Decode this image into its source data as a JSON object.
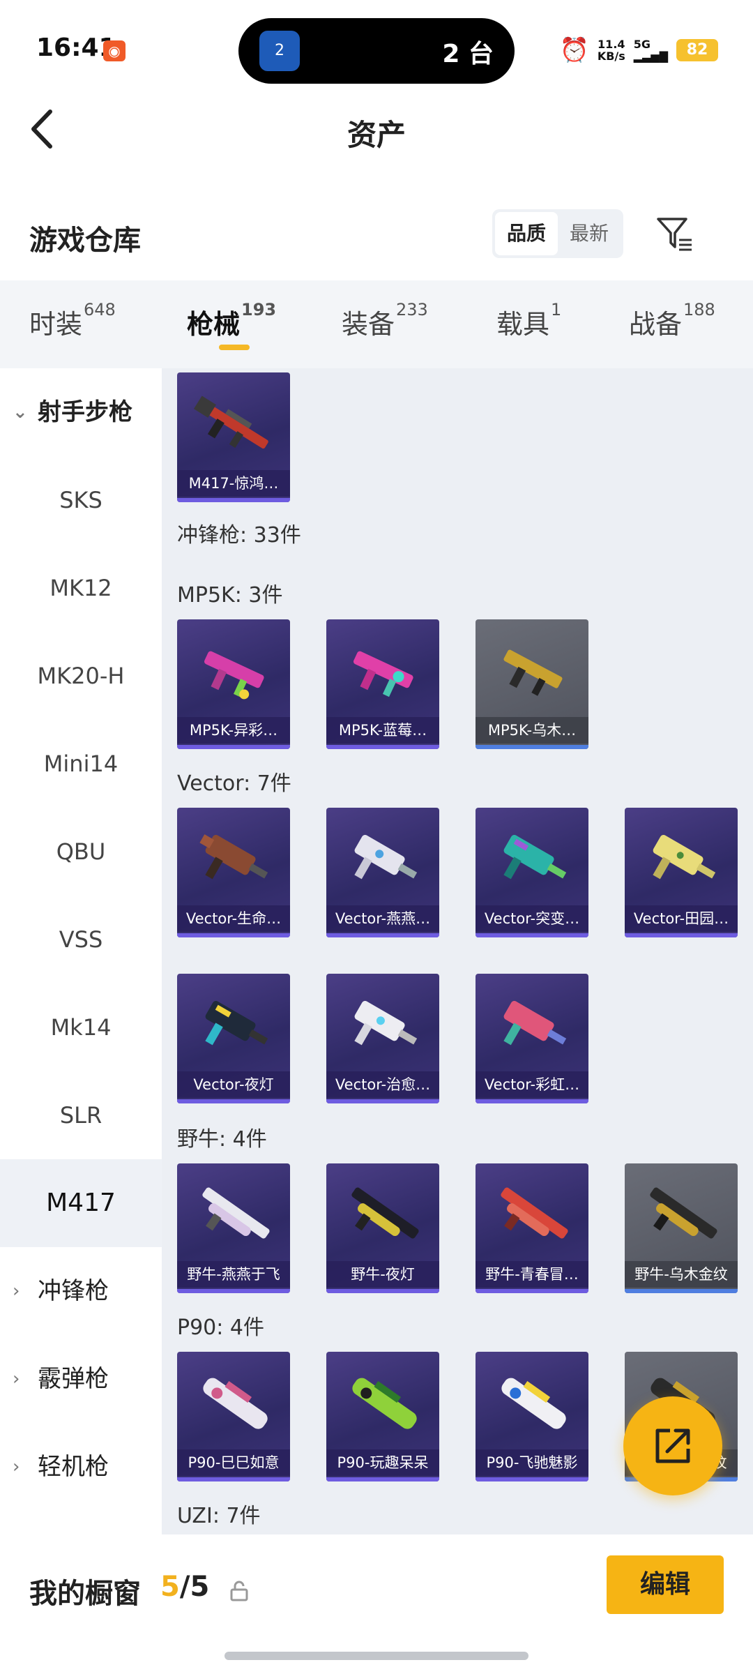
{
  "status_bar": {
    "time": "16:41",
    "island_badge": "2",
    "island_text": "2 台",
    "net_speed_value": "11.4",
    "net_speed_unit": "KB/s",
    "signal_label": "5G",
    "battery": "82"
  },
  "header": {
    "title": "资产"
  },
  "section": {
    "title": "游戏仓库",
    "sort_options": [
      "品质",
      "最新"
    ],
    "active_sort": "品质"
  },
  "tabs": [
    {
      "label": "时装",
      "count": "648"
    },
    {
      "label": "枪械",
      "count": "193"
    },
    {
      "label": "装备",
      "count": "233"
    },
    {
      "label": "载具",
      "count": "1"
    },
    {
      "label": "战备",
      "count": "188"
    }
  ],
  "active_tab": "枪械",
  "sidebar": {
    "group_open": "射手步枪",
    "sub_items": [
      "SKS",
      "MK12",
      "MK20-H",
      "Mini14",
      "QBU",
      "VSS",
      "Mk14",
      "SLR",
      "M417"
    ],
    "selected": "M417",
    "groups_closed": [
      "冲锋枪",
      "霰弹枪",
      "轻机枪"
    ]
  },
  "content": {
    "top_card": {
      "name": "M417-惊鸿…"
    },
    "category_header": "冲锋枪: 33件",
    "groups": [
      {
        "label": "MP5K: 3件",
        "items": [
          "MP5K-异彩…",
          "MP5K-蓝莓…",
          "MP5K-乌木…"
        ]
      },
      {
        "label": "Vector: 7件",
        "items": [
          "Vector-生命…",
          "Vector-燕燕…",
          "Vector-突变…",
          "Vector-田园…",
          "Vector-夜灯",
          "Vector-治愈…",
          "Vector-彩虹…"
        ]
      },
      {
        "label": "野牛: 4件",
        "items": [
          "野牛-燕燕于飞",
          "野牛-夜灯",
          "野牛-青春冒…",
          "野牛-乌木金纹"
        ]
      },
      {
        "label": "P90: 4件",
        "items": [
          "P90-巳巳如意",
          "P90-玩趣呆呆",
          "P90-飞驰魅影",
          "P90-乌木金纹"
        ]
      },
      {
        "label": "UZI: 7件",
        "items": []
      }
    ]
  },
  "bottom": {
    "showcase_label": "我的橱窗",
    "showcase_current": "5",
    "showcase_total": "/5",
    "edit_label": "编辑"
  },
  "colors": {
    "accent": "#f6b414",
    "card_purple": "#3d3378",
    "card_gray": "#5a5d66"
  },
  "icons": [
    "back-arrow-icon",
    "filter-icon",
    "lock-icon",
    "share-icon",
    "alarm-icon"
  ]
}
